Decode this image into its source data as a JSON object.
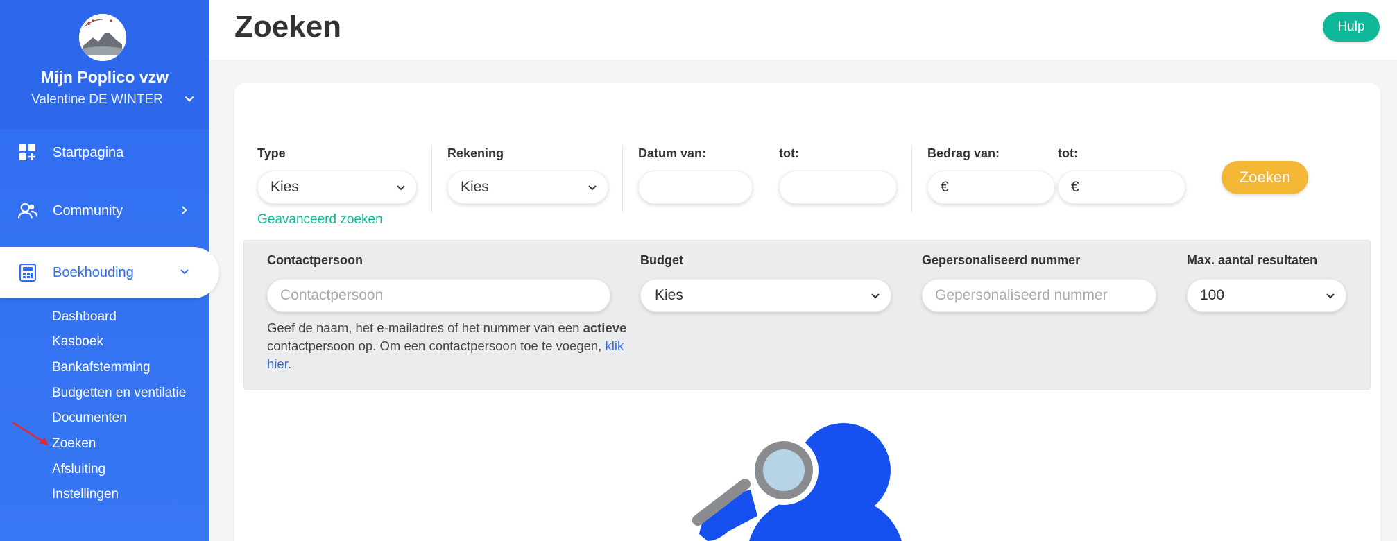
{
  "sidebar": {
    "org_name": "Mijn Poplico vzw",
    "user_name": "Valentine DE WINTER",
    "nav": [
      {
        "label": "Startpagina",
        "icon": "dashboard-plus-icon"
      },
      {
        "label": "Community",
        "icon": "users-icon"
      },
      {
        "label": "Boekhouding",
        "icon": "calculator-icon"
      }
    ],
    "sub_items": [
      "Dashboard",
      "Kasboek",
      "Bankafstemming",
      "Budgetten en ventilatie",
      "Documenten",
      "Zoeken",
      "Afsluiting",
      "Instellingen"
    ]
  },
  "header": {
    "title": "Zoeken",
    "help_label": "Hulp"
  },
  "filters": {
    "type_label": "Type",
    "type_value": "Kies",
    "rekening_label": "Rekening",
    "rekening_value": "Kies",
    "datum_van_label": "Datum van:",
    "datum_tot_label": "tot:",
    "bedrag_van_label": "Bedrag van:",
    "bedrag_tot_label": "tot:",
    "currency": "€",
    "search_label": "Zoeken",
    "advanced_link": "Geavanceerd zoeken"
  },
  "advanced": {
    "contact_label": "Contactpersoon",
    "contact_placeholder": "Contactpersoon",
    "budget_label": "Budget",
    "budget_value": "Kies",
    "custom_number_label": "Gepersonaliseerd nummer",
    "custom_number_placeholder": "Gepersonaliseerd nummer",
    "max_results_label": "Max. aantal resultaten",
    "max_results_value": "100",
    "help_text_1": "Geef de naam, het e-mailadres of het nummer van een ",
    "help_text_bold": "actieve",
    "help_text_2": " contactpersoon op. Om een contactpersoon toe te voegen, ",
    "help_text_link": "klik hier",
    "help_text_3": "."
  },
  "colors": {
    "sidebar": "#2f6df0",
    "accent_green": "#10b89a",
    "accent_yellow": "#f3b735",
    "illustration_blue": "#1651f0"
  }
}
